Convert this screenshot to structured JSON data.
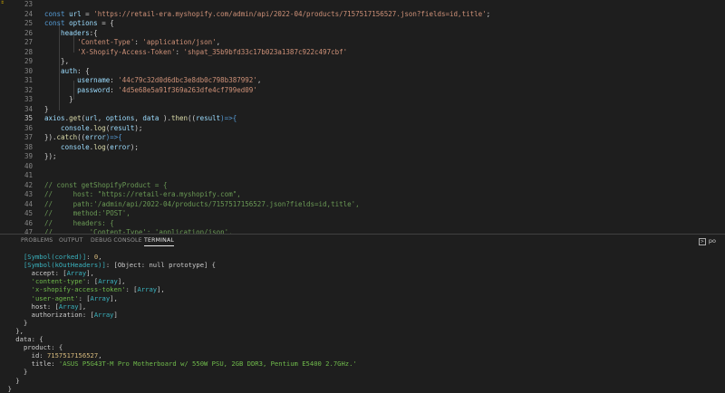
{
  "editor": {
    "corner_glyph": "ะ",
    "line_numbers": [
      "23",
      "24",
      "25",
      "26",
      "27",
      "28",
      "29",
      "30",
      "31",
      "32",
      "33",
      "34",
      "35",
      "36",
      "37",
      "38",
      "39",
      "40",
      "41",
      "42",
      "43",
      "44",
      "45",
      "46",
      "47"
    ],
    "active_line": "35",
    "lines": [
      [],
      [
        {
          "t": "const ",
          "c": "kw"
        },
        {
          "t": "url",
          "c": "v"
        },
        {
          "t": " = ",
          "c": "p"
        },
        {
          "t": "'https://retail-era.myshopify.com/admin/api/2022-04/products/7157517156527.json?fields=id,title'",
          "c": "s"
        },
        {
          "t": ";",
          "c": "p"
        }
      ],
      [
        {
          "t": "const ",
          "c": "kw"
        },
        {
          "t": "options",
          "c": "v"
        },
        {
          "t": " = {",
          "c": "p"
        }
      ],
      [
        {
          "t": "    headers",
          "c": "v"
        },
        {
          "t": ":{",
          "c": "p"
        }
      ],
      [
        {
          "t": "        'Content-Type'",
          "c": "s"
        },
        {
          "t": ": ",
          "c": "p"
        },
        {
          "t": "'application/json'",
          "c": "s"
        },
        {
          "t": ",",
          "c": "p"
        }
      ],
      [
        {
          "t": "        'X-Shopify-Access-Token'",
          "c": "s"
        },
        {
          "t": ": ",
          "c": "p"
        },
        {
          "t": "'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'",
          "c": "s"
        }
      ],
      [
        {
          "t": "    },",
          "c": "p"
        }
      ],
      [
        {
          "t": "    auth",
          "c": "v"
        },
        {
          "t": ": {",
          "c": "p"
        }
      ],
      [
        {
          "t": "        username",
          "c": "v"
        },
        {
          "t": ": ",
          "c": "p"
        },
        {
          "t": "'44c79c32d0d6dbc3e8db0c798b387992'",
          "c": "s"
        },
        {
          "t": ",",
          "c": "p"
        }
      ],
      [
        {
          "t": "        password",
          "c": "v"
        },
        {
          "t": ": ",
          "c": "p"
        },
        {
          "t": "'4d5e68e5a91f369a263dfe4cf799ed09'",
          "c": "s"
        }
      ],
      [
        {
          "t": "      }",
          "c": "p"
        }
      ],
      [
        {
          "t": "}",
          "c": "p"
        }
      ],
      [
        {
          "t": "axios",
          "c": "v"
        },
        {
          "t": ".",
          "c": "p"
        },
        {
          "t": "get",
          "c": "f"
        },
        {
          "t": "(",
          "c": "p"
        },
        {
          "t": "url",
          "c": "v"
        },
        {
          "t": ", ",
          "c": "p"
        },
        {
          "t": "options",
          "c": "v"
        },
        {
          "t": ", ",
          "c": "p"
        },
        {
          "t": "data",
          "c": "v"
        },
        {
          "t": " ).",
          "c": "p"
        },
        {
          "t": "then",
          "c": "f"
        },
        {
          "t": "((",
          "c": "p"
        },
        {
          "t": "result",
          "c": "v"
        },
        {
          "t": ")=>{",
          "c": "kw"
        }
      ],
      [
        {
          "t": "    console",
          "c": "v"
        },
        {
          "t": ".",
          "c": "p"
        },
        {
          "t": "log",
          "c": "f"
        },
        {
          "t": "(",
          "c": "p"
        },
        {
          "t": "result",
          "c": "v"
        },
        {
          "t": ");",
          "c": "p"
        }
      ],
      [
        {
          "t": "}).",
          "c": "p"
        },
        {
          "t": "catch",
          "c": "f"
        },
        {
          "t": "((",
          "c": "p"
        },
        {
          "t": "error",
          "c": "v"
        },
        {
          "t": ")=>{",
          "c": "kw"
        }
      ],
      [
        {
          "t": "    console",
          "c": "v"
        },
        {
          "t": ".",
          "c": "p"
        },
        {
          "t": "log",
          "c": "f"
        },
        {
          "t": "(",
          "c": "p"
        },
        {
          "t": "error",
          "c": "v"
        },
        {
          "t": ");",
          "c": "p"
        }
      ],
      [
        {
          "t": "});",
          "c": "p"
        }
      ],
      [],
      [],
      [
        {
          "t": "// const getShopifyProduct = {",
          "c": "c"
        }
      ],
      [
        {
          "t": "//     host: \"https://retail-era.myshopify.com\",",
          "c": "c"
        }
      ],
      [
        {
          "t": "//     path:'/admin/api/2022-04/products/7157517156527.json?fields=id,title',",
          "c": "c"
        }
      ],
      [
        {
          "t": "//     method:'POST',",
          "c": "c"
        }
      ],
      [
        {
          "t": "//     headers: {",
          "c": "c"
        }
      ],
      [
        {
          "t": "//         'Content-Type': 'application/json',",
          "c": "c"
        }
      ]
    ]
  },
  "panel": {
    "tabs": [
      {
        "label": "PROBLEMS",
        "active": false
      },
      {
        "label": "OUTPUT",
        "active": false
      },
      {
        "label": "DEBUG CONSOLE",
        "active": false
      },
      {
        "label": "TERMINAL",
        "active": true
      }
    ],
    "shell_label": "po"
  },
  "terminal": {
    "lines": [
      [
        {
          "t": "      "
        },
        {
          "t": "[Symbol(corked)]",
          "c": "t-cyan"
        },
        {
          "t": ": "
        },
        {
          "t": "0",
          "c": "t-num"
        },
        {
          "t": ","
        }
      ],
      [
        {
          "t": "      "
        },
        {
          "t": "[Symbol(kOutHeaders)]",
          "c": "t-cyan"
        },
        {
          "t": ": [Object: null prototype] {"
        }
      ],
      [
        {
          "t": "        accept: ["
        },
        {
          "t": "Array",
          "c": "t-cyan"
        },
        {
          "t": "],"
        }
      ],
      [
        {
          "t": "        "
        },
        {
          "t": "'content-type'",
          "c": "t-green"
        },
        {
          "t": ": ["
        },
        {
          "t": "Array",
          "c": "t-cyan"
        },
        {
          "t": "],"
        }
      ],
      [
        {
          "t": "        "
        },
        {
          "t": "'x-shopify-access-token'",
          "c": "t-green"
        },
        {
          "t": ": ["
        },
        {
          "t": "Array",
          "c": "t-cyan"
        },
        {
          "t": "],"
        }
      ],
      [
        {
          "t": "        "
        },
        {
          "t": "'user-agent'",
          "c": "t-green"
        },
        {
          "t": ": ["
        },
        {
          "t": "Array",
          "c": "t-cyan"
        },
        {
          "t": "],"
        }
      ],
      [
        {
          "t": "        host: ["
        },
        {
          "t": "Array",
          "c": "t-cyan"
        },
        {
          "t": "],"
        }
      ],
      [
        {
          "t": "        authorization: ["
        },
        {
          "t": "Array",
          "c": "t-cyan"
        },
        {
          "t": "]"
        }
      ],
      [
        {
          "t": "      }"
        }
      ],
      [
        {
          "t": "    },"
        }
      ],
      [
        {
          "t": "    data: {"
        }
      ],
      [
        {
          "t": "      product: {"
        }
      ],
      [
        {
          "t": "        id: "
        },
        {
          "t": "7157517156527",
          "c": "t-num"
        },
        {
          "t": ","
        }
      ],
      [
        {
          "t": "        title: "
        },
        {
          "t": "'ASUS P5G43T-M Pro Motherboard w/ 550W PSU, 2GB DDR3, Pentium E5400 2.7GHz.'",
          "c": "t-green"
        }
      ],
      [
        {
          "t": "      }"
        }
      ],
      [
        {
          "t": "    }"
        }
      ],
      [
        {
          "t": "  }"
        }
      ]
    ]
  }
}
